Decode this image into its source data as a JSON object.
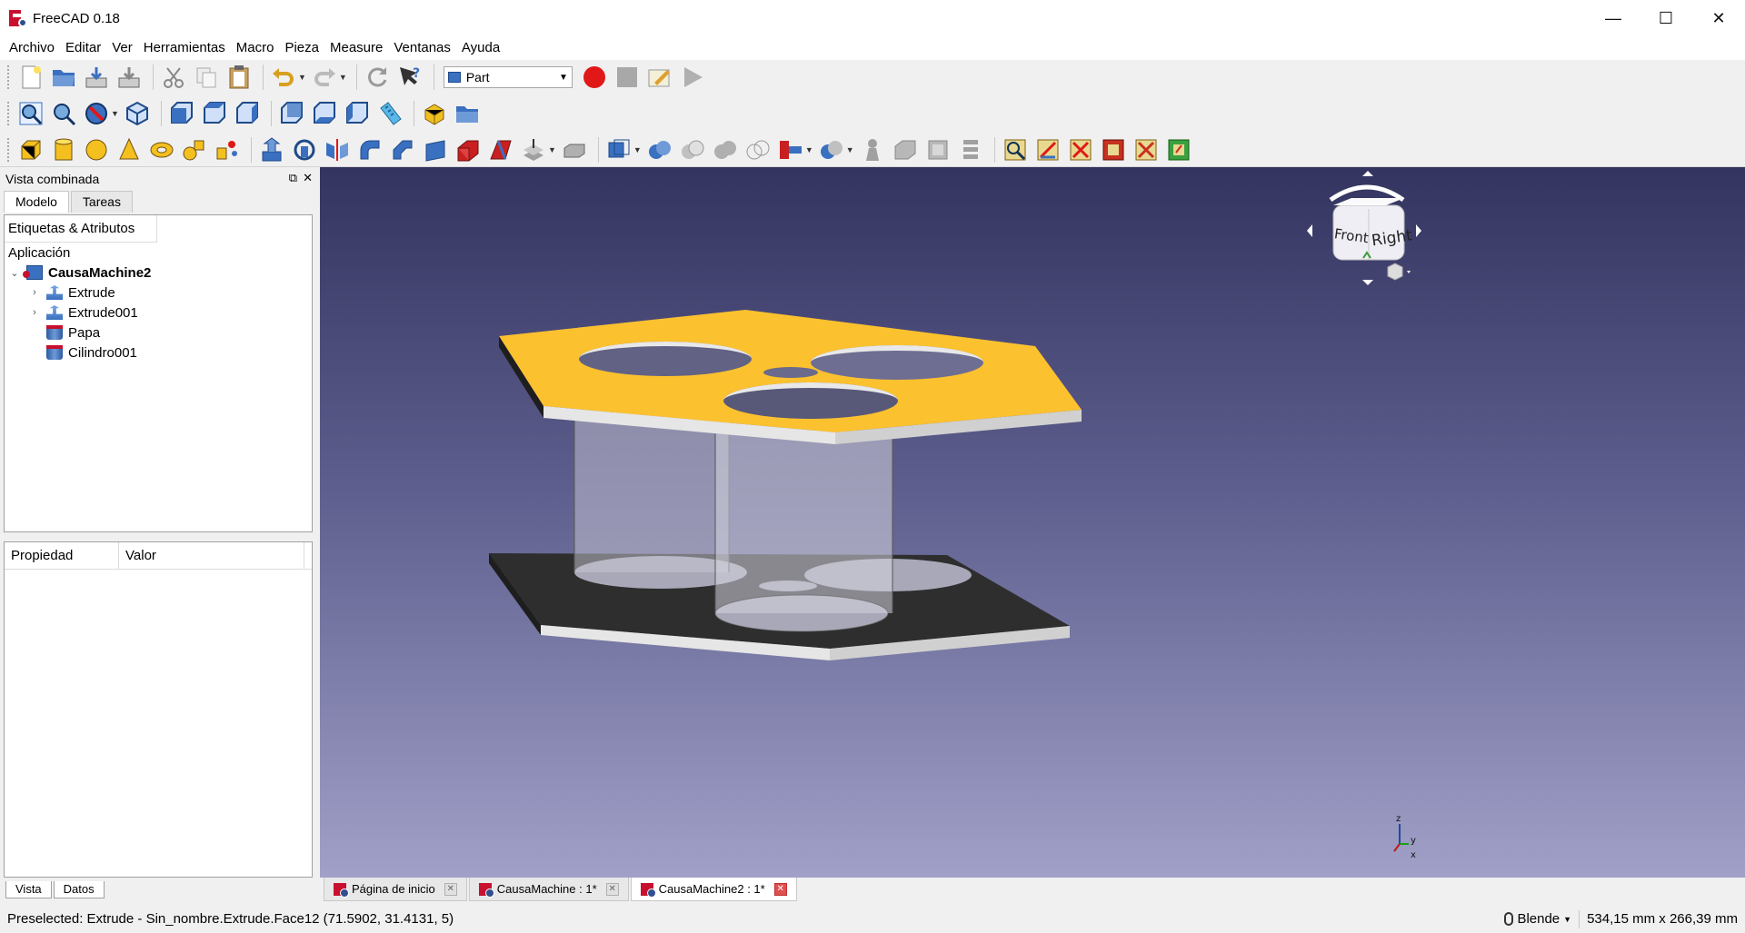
{
  "window": {
    "title": "FreeCAD 0.18",
    "minimize": "—",
    "maximize": "☐",
    "close": "✕"
  },
  "menu": [
    "Archivo",
    "Editar",
    "Ver",
    "Herramientas",
    "Macro",
    "Pieza",
    "Measure",
    "Ventanas",
    "Ayuda"
  ],
  "workbench": {
    "selected": "Part"
  },
  "combo": {
    "title": "Vista combinada",
    "tabs": [
      "Modelo",
      "Tareas"
    ],
    "tree_header": "Etiquetas & Atributos",
    "app_label": "Aplicación",
    "document": "CausaMachine2",
    "items": [
      "Extrude",
      "Extrude001",
      "Papa",
      "Cilindro001"
    ],
    "prop_cols": [
      "Propiedad",
      "Valor"
    ],
    "bottom_tabs": [
      "Vista",
      "Datos"
    ]
  },
  "navcube": {
    "front": "Front",
    "right": "Right"
  },
  "axis": {
    "z": "z",
    "y": "y",
    "x": "x"
  },
  "view_tabs": [
    "Página de inicio",
    "CausaMachine : 1*",
    "CausaMachine2 : 1*"
  ],
  "status": {
    "message": "Preselected: Extrude - Sin_nombre.Extrude.Face12 (71.5902, 31.4131, 5)",
    "nav_style": "Blende",
    "dimensions": "534,15 mm x 266,39 mm"
  },
  "colors": {
    "top_plate": "#fcc12f",
    "bottom_plate": "#2e2e2e",
    "record": "#e01818",
    "accent": "#3a70c0"
  }
}
